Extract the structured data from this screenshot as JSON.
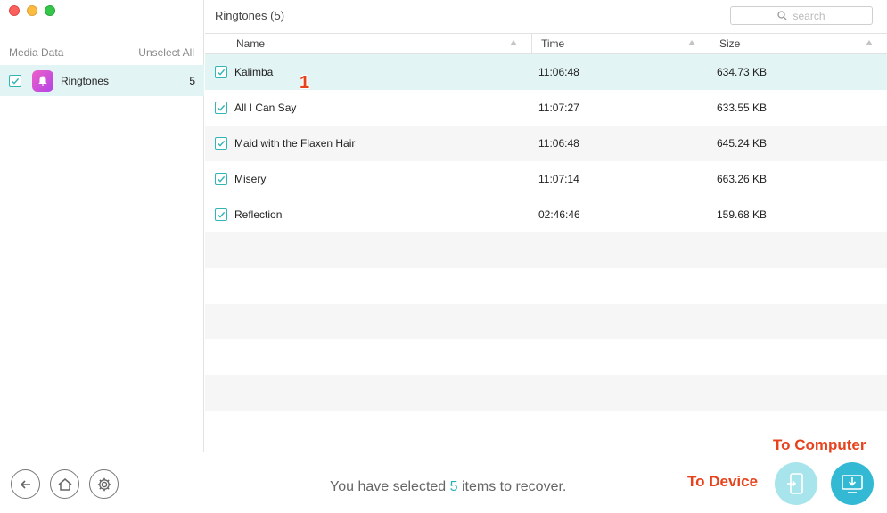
{
  "sidebar": {
    "header_left": "Media Data",
    "header_right": "Unselect All",
    "items": [
      {
        "label": "Ringtones",
        "count": "5",
        "checked": true,
        "icon": "bell-icon"
      }
    ]
  },
  "main": {
    "title": "Ringtones (5)",
    "search_placeholder": "search",
    "columns": [
      "Name",
      "Time",
      "Size"
    ],
    "rows": [
      {
        "name": "Kalimba",
        "time": "11:06:48",
        "size": "634.73 KB",
        "checked": true,
        "selected": true
      },
      {
        "name": "All I Can Say",
        "time": "11:07:27",
        "size": "633.55 KB",
        "checked": true
      },
      {
        "name": "Maid with the Flaxen Hair",
        "time": "11:06:48",
        "size": "645.24 KB",
        "checked": true
      },
      {
        "name": "Misery",
        "time": "11:07:14",
        "size": "663.26 KB",
        "checked": true
      },
      {
        "name": "Reflection",
        "time": "02:46:46",
        "size": "159.68 KB",
        "checked": true
      }
    ],
    "annotation": "1"
  },
  "footer": {
    "status_prefix": "You have selected ",
    "status_count": "5",
    "status_suffix": " items to recover.",
    "to_device_label": "To Device",
    "to_computer_label": "To Computer"
  },
  "colors": {
    "accent": "#33b9d3",
    "selection": "#e3f4f4",
    "annotation": "#e8421c"
  }
}
